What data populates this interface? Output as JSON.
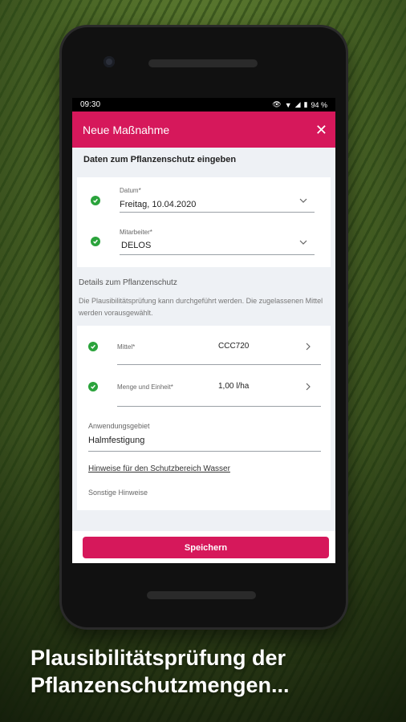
{
  "statusbar": {
    "time": "09:30",
    "battery": "94 %"
  },
  "appbar": {
    "title": "Neue Maßnahme",
    "close_icon": "close-icon"
  },
  "section_header": "Daten zum Pflanzenschutz eingeben",
  "form": {
    "datum_label": "Datum*",
    "datum_value": "Freitag, 10.04.2020",
    "mitarbeiter_label": "Mitarbeiter*",
    "mitarbeiter_value": "DELOS"
  },
  "details": {
    "title": "Details zum Pflanzenschutz",
    "info": "Die Plausibilitätsprüfung kann durchgeführt werden. Die zugelassenen Mittel werden vorausgewählt.",
    "mittel_label": "Mittel*",
    "mittel_value": "CCC720",
    "menge_label": "Menge und Einheit*",
    "menge_value": "1,00 l/ha",
    "anwendung_label": "Anwendungsgebiet",
    "anwendung_value": "Halmfestigung",
    "hinweise_link": "Hinweise für den Schutzbereich Wasser",
    "sonstige_label": "Sonstige Hinweise"
  },
  "save_label": "Speichern",
  "caption": {
    "line1": "Plausibilitätsprüfung der",
    "line2": "Pflanzenschutzmengen..."
  },
  "colors": {
    "accent": "#d6185b",
    "check": "#2aa33b"
  }
}
